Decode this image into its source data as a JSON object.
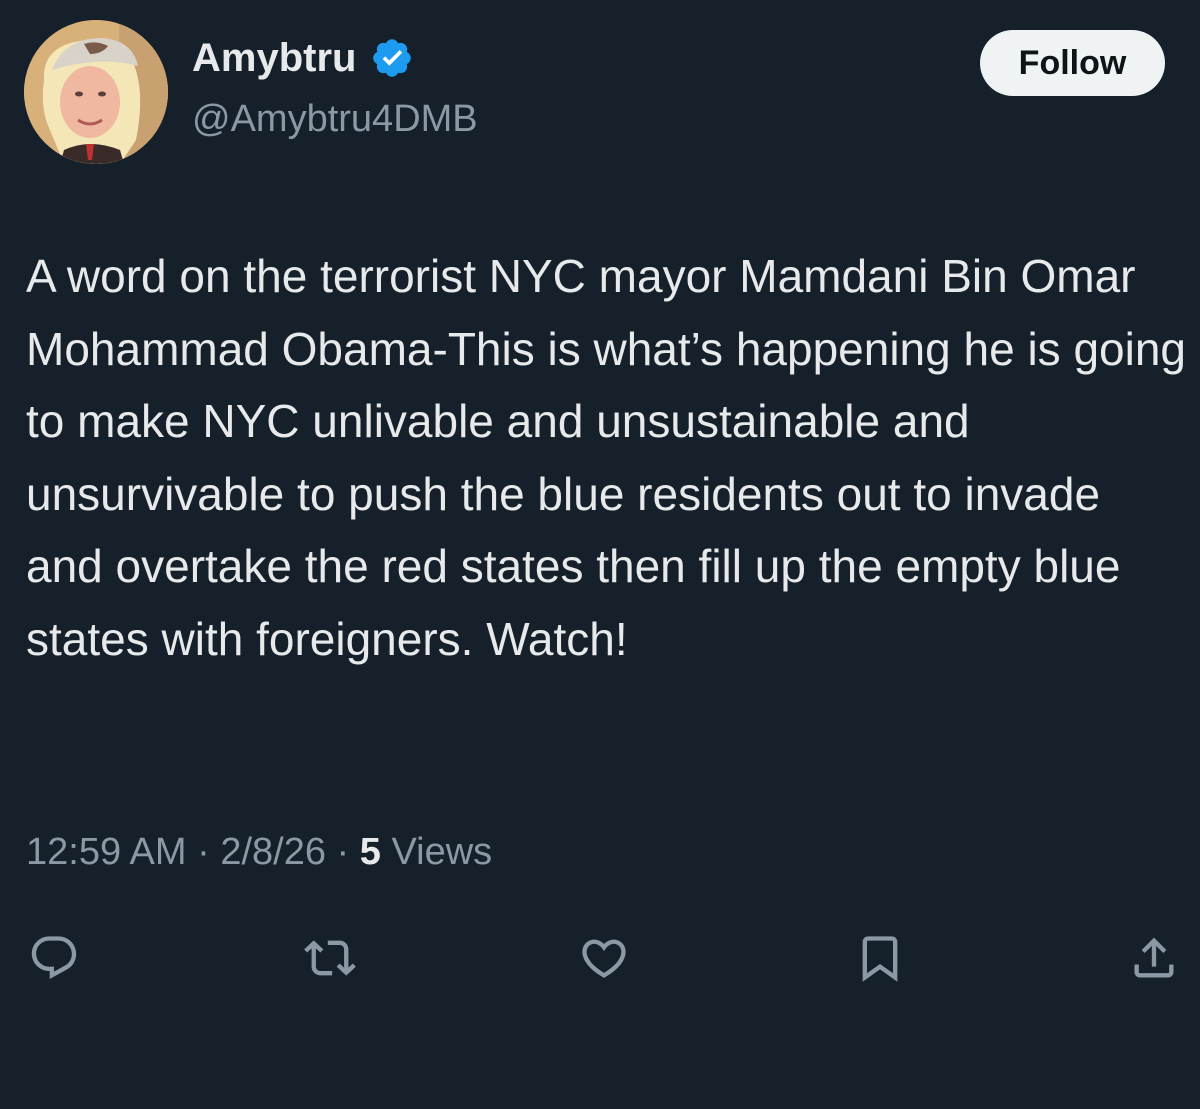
{
  "author": {
    "display_name": "Amybtru",
    "handle": "@Amybtru4DMB",
    "verified_icon": "verified-badge-icon",
    "verified_color": "#1d9bf0"
  },
  "header": {
    "follow_label": "Follow"
  },
  "tweet": {
    "text": "A word on the terrorist NYC mayor Mamdani Bin Omar Mohammad Obama-This is what’s happening he is going to make NYC unlivable and unsustainable and unsurvivable to push the blue residents out to invade and overtake the red states then fill up the empty blue states with foreigners. Watch!"
  },
  "meta": {
    "time": "12:59 AM",
    "separator": " · ",
    "date": "2/8/26",
    "views_count": "5",
    "views_label": " Views"
  },
  "actions": [
    {
      "icon": "reply-icon"
    },
    {
      "icon": "retweet-icon"
    },
    {
      "icon": "like-icon"
    },
    {
      "icon": "bookmark-icon"
    },
    {
      "icon": "share-icon"
    }
  ],
  "colors": {
    "background": "#15202b",
    "primary_text": "#e7e9ea",
    "secondary_text": "#8b98a5",
    "accent": "#1d9bf0",
    "follow_button_bg": "#eff3f4"
  }
}
